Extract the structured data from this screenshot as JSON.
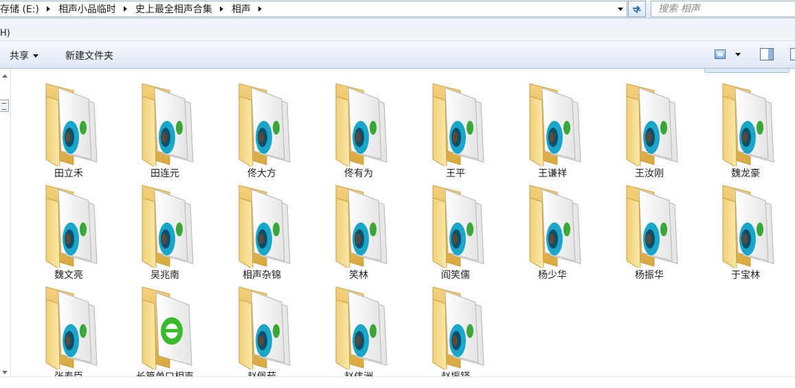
{
  "address_bar": {
    "crumbs": [
      "存储 (E:)",
      "相声小品临时",
      "史上最全相声合集",
      "相声"
    ]
  },
  "search": {
    "placeholder": "搜索 相声"
  },
  "menu": {
    "partial_label": "H)"
  },
  "toolbar": {
    "share_label": "共享",
    "new_folder_label": "新建文件夹"
  },
  "folders": [
    {
      "name": "田立禾",
      "kind": "media"
    },
    {
      "name": "田连元",
      "kind": "media"
    },
    {
      "name": "佟大方",
      "kind": "media"
    },
    {
      "name": "佟有为",
      "kind": "media"
    },
    {
      "name": "王平",
      "kind": "media"
    },
    {
      "name": "王谦祥",
      "kind": "media"
    },
    {
      "name": "王汝刚",
      "kind": "media"
    },
    {
      "name": "魏龙豪",
      "kind": "media"
    },
    {
      "name": "魏文亮",
      "kind": "media"
    },
    {
      "name": "吴兆南",
      "kind": "media"
    },
    {
      "name": "相声杂锦",
      "kind": "media"
    },
    {
      "name": "笑林",
      "kind": "media"
    },
    {
      "name": "阎笑儒",
      "kind": "media"
    },
    {
      "name": "杨少华",
      "kind": "media"
    },
    {
      "name": "杨振华",
      "kind": "media"
    },
    {
      "name": "于宝林",
      "kind": "media"
    },
    {
      "name": "张寿臣",
      "kind": "media"
    },
    {
      "name": "长篇单口相声",
      "kind": "browser"
    },
    {
      "name": "赵佩茹",
      "kind": "media"
    },
    {
      "name": "赵伟洲",
      "kind": "media"
    },
    {
      "name": "赵振铎",
      "kind": "media"
    }
  ],
  "colors": {
    "folder_back": "#e9c266",
    "folder_front": "#f6dc8c",
    "media_teal": "#1aa6c9",
    "media_green": "#3aa635",
    "browser_green": "#3cba2e"
  }
}
